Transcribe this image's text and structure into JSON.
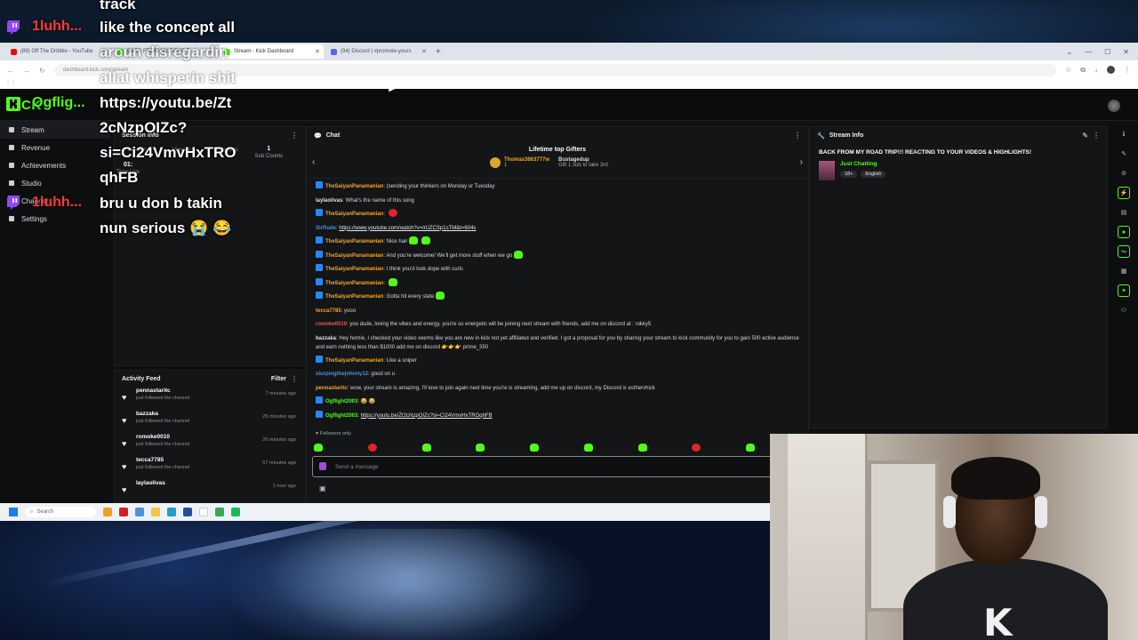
{
  "browser": {
    "tabs": [
      {
        "title": "(89) Off The Dribble - YouTube",
        "color": "#ff0000"
      },
      {
        "title": "BACK FROM MY ROAD T",
        "color": "#53fc18"
      },
      {
        "title": "Stream - Kick Dashboard",
        "color": "#53fc18",
        "active": true
      },
      {
        "title": "(94) Discord | #promote-yours",
        "color": "#5865f2"
      }
    ],
    "url": "dashboard.kick.com/stream"
  },
  "kick": {
    "logo": "KICK",
    "sidebar": [
      {
        "label": "Stream",
        "active": true
      },
      {
        "label": "Revenue"
      },
      {
        "label": "Achievements"
      },
      {
        "label": "Studio"
      },
      {
        "label": "Channel"
      },
      {
        "label": "Settings"
      }
    ],
    "session": {
      "title": "Session info",
      "labels": [
        "Session",
        "Viewers",
        "Followers",
        "Sub Counts",
        "Time Live"
      ],
      "values": [
        "",
        "",
        "",
        "1",
        "01:"
      ]
    },
    "activity": {
      "title": "Activity Feed",
      "filter": "Filter",
      "rows": [
        {
          "name": "pennastaritc",
          "action": "just followed the channel",
          "time": "7 minutes ago"
        },
        {
          "name": "bazzaka",
          "action": "just followed the channel",
          "time": "25 minutes ago"
        },
        {
          "name": "romoke0010",
          "action": "just followed the channel",
          "time": "26 minutes ago"
        },
        {
          "name": "tecca7785",
          "action": "just followed the channel",
          "time": "57 minutes ago"
        },
        {
          "name": "laylaolivas",
          "action": "",
          "time": "1 hour ago"
        }
      ]
    },
    "chat": {
      "title": "Chat",
      "gifters_title": "Lifetime top Gifters",
      "gifter1": "Thomas3663777w",
      "gifter1_count": "1",
      "gifter2": "Bustagedup",
      "gifter2_note": "Gift 1 sub to take 3rd",
      "placeholder": "Send a message",
      "followers_only": "Followers only",
      "messages": [
        {
          "user": "TheSaiyanPanamanian",
          "color": "#f5a623",
          "badge": true,
          "text": "(sending your thinkers on Monday or Tuesday"
        },
        {
          "user": "laylaolivas",
          "color": "#e0e0e0",
          "badge": false,
          "text": "What's the name of this song"
        },
        {
          "user": "TheSaiyanPanamanian",
          "color": "#f5a623",
          "badge": true,
          "text": "",
          "emote": "red"
        },
        {
          "user": "SirRude",
          "color": "#4a90e2",
          "badge": false,
          "link": "https://www.youtube.com/watch?v=lrUZCSp1sTM&t=604s"
        },
        {
          "user": "TheSaiyanPanamanian",
          "color": "#f5a623",
          "badge": true,
          "text": "Nice hair",
          "emote": "green2"
        },
        {
          "user": "TheSaiyanPanamanian",
          "color": "#f5a623",
          "badge": true,
          "text": "And you're welcome! We'll get more stuff when we go",
          "emote": "green"
        },
        {
          "user": "TheSaiyanPanamanian",
          "color": "#f5a623",
          "badge": true,
          "text": "I think you'd look dope with curls"
        },
        {
          "user": "TheSaiyanPanamanian",
          "color": "#f5a623",
          "badge": true,
          "text": "",
          "emote": "green"
        },
        {
          "user": "TheSaiyanPanamanian",
          "color": "#f5a623",
          "badge": true,
          "text": "Gotta hit every state",
          "emote": "green"
        },
        {
          "user": "tecca7785",
          "color": "#f5a623",
          "badge": false,
          "text": "yooo"
        },
        {
          "user": "romoke0010",
          "color": "#e05a5a",
          "badge": false,
          "text": "yoo dude, loving the vibes and energy, you're so energetic will be joining next stream with friends, add me on discord at : rokky5"
        },
        {
          "user": "bazzaka",
          "color": "#e0e0e0",
          "badge": false,
          "wrap": true,
          "text": "Hey homie, I checked your video seems like you are new in kick not yet affiliated and verified. I got a proposal for you by sharing your stream to kick community for you to gain 500 active audience and earn nothing less than $1000 add me on discord 👉👉👉 prime_350"
        },
        {
          "user": "TheSaiyanPanamanian",
          "color": "#f5a623",
          "badge": true,
          "text": "Like a sniper"
        },
        {
          "user": "slurpingthejohnny12",
          "color": "#4a90e2",
          "badge": false,
          "text": "good on u"
        },
        {
          "user": "pennastaritc",
          "color": "#f5a623",
          "badge": false,
          "text": "wow, your stream is amazing, I'll love to join again next time you're is streaming, add me up on discord, my Discord is esthervhick"
        },
        {
          "user": "Ogflight2003",
          "color": "#53fc18",
          "badge": true,
          "text": "😂 😂"
        },
        {
          "user": "Ogflight2003",
          "color": "#53fc18",
          "badge": true,
          "link": "https://youtu.be/Zt2cNzpOIZc?si=Ci24VmvHxTROqhFB"
        }
      ]
    },
    "stream_info": {
      "title": "Stream Info",
      "stream_title": "BACK FROM MY ROAD TRIP!!! REACTING TO YOUR VIDEOS & HIGHLIGHTS!",
      "category": "Just Chatting",
      "tags": [
        "18+",
        "English"
      ]
    }
  },
  "taskbar": {
    "search": "Search"
  },
  "overlay": {
    "lines": [
      "track",
      "like the concept all",
      "aroun disregardin",
      "allat whisperin shit",
      "https://youtu.be/Zt",
      "2cNzpOIZc?",
      "si=Ci24VmvHxTRO",
      "qhFB",
      "bru u don b takin",
      "nun serious 😭 😂"
    ],
    "user1": "1luhh...",
    "user2": "Ogflig...",
    "user3": "1luhh..."
  },
  "colors": {
    "kick_green": "#53fc18",
    "twitch_purple": "#9146ff"
  }
}
